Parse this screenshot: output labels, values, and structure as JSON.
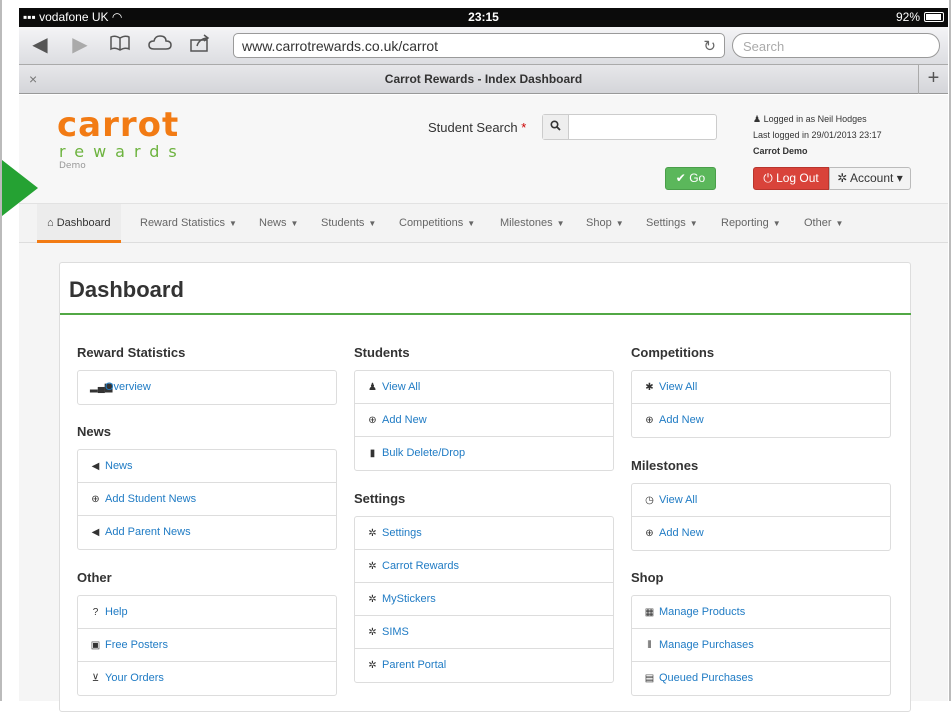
{
  "status_bar": {
    "carrier": "vodafone UK",
    "time": "23:15",
    "battery": "92%"
  },
  "browser": {
    "url": "www.carrotrewards.co.uk/carrot",
    "search_placeholder": "Search",
    "tab_title": "Carrot Rewards - Index Dashboard",
    "tab_close": "×",
    "tab_add": "+"
  },
  "logo": {
    "word": "carrot",
    "sub": "rewards",
    "tag": "Demo"
  },
  "header": {
    "search_label": "Student Search",
    "search_required": "*",
    "search_value": "",
    "go_label": "Go",
    "logged_in": "Logged in as Neil Hodges",
    "last_logged": "Last logged in 29/01/2013 23:17",
    "school": "Carrot Demo",
    "logout_label": "Log Out",
    "account_label": "Account"
  },
  "nav": {
    "items": [
      {
        "label": "Dashboard",
        "icon": "home-icon"
      },
      {
        "label": "Reward Statistics"
      },
      {
        "label": "News"
      },
      {
        "label": "Students"
      },
      {
        "label": "Competitions"
      },
      {
        "label": "Milestones"
      },
      {
        "label": "Shop"
      },
      {
        "label": "Settings"
      },
      {
        "label": "Reporting"
      },
      {
        "label": "Other"
      }
    ]
  },
  "dashboard": {
    "title": "Dashboard",
    "reward_statistics": {
      "title": "Reward Statistics",
      "items": [
        {
          "label": "Overview",
          "icon": "bar-chart-icon"
        }
      ]
    },
    "news": {
      "title": "News",
      "items": [
        {
          "label": "News",
          "icon": "bullhorn-icon"
        },
        {
          "label": "Add Student News",
          "icon": "plus-circle-icon"
        },
        {
          "label": "Add Parent News",
          "icon": "bullhorn-icon"
        }
      ]
    },
    "other": {
      "title": "Other",
      "items": [
        {
          "label": "Help",
          "icon": "question-circle-icon"
        },
        {
          "label": "Free Posters",
          "icon": "picture-icon"
        },
        {
          "label": "Your Orders",
          "icon": "shopping-cart-icon"
        }
      ]
    },
    "students": {
      "title": "Students",
      "items": [
        {
          "label": "View All",
          "icon": "user-icon"
        },
        {
          "label": "Add New",
          "icon": "plus-circle-icon"
        },
        {
          "label": "Bulk Delete/Drop",
          "icon": "trash-icon"
        }
      ]
    },
    "settings": {
      "title": "Settings",
      "items": [
        {
          "label": "Settings",
          "icon": "cog-icon"
        },
        {
          "label": "Carrot Rewards",
          "icon": "cog-icon"
        },
        {
          "label": "MyStickers",
          "icon": "cog-icon"
        },
        {
          "label": "SIMS",
          "icon": "cog-icon"
        },
        {
          "label": "Parent Portal",
          "icon": "cog-icon"
        }
      ]
    },
    "competitions": {
      "title": "Competitions",
      "items": [
        {
          "label": "View All",
          "icon": "asterisk-icon"
        },
        {
          "label": "Add New",
          "icon": "plus-circle-icon"
        }
      ]
    },
    "milestones": {
      "title": "Milestones",
      "items": [
        {
          "label": "View All",
          "icon": "clock-icon"
        },
        {
          "label": "Add New",
          "icon": "plus-circle-icon"
        }
      ]
    },
    "shop": {
      "title": "Shop",
      "items": [
        {
          "label": "Manage Products",
          "icon": "grid-icon"
        },
        {
          "label": "Manage Purchases",
          "icon": "barcode-icon"
        },
        {
          "label": "Queued Purchases",
          "icon": "list-icon"
        }
      ]
    }
  },
  "colors": {
    "brand_orange": "#f27b14",
    "brand_green": "#6db33f",
    "go_green": "#5bb75b",
    "logout_red": "#d9433a",
    "link_blue": "#1f7bc4"
  }
}
